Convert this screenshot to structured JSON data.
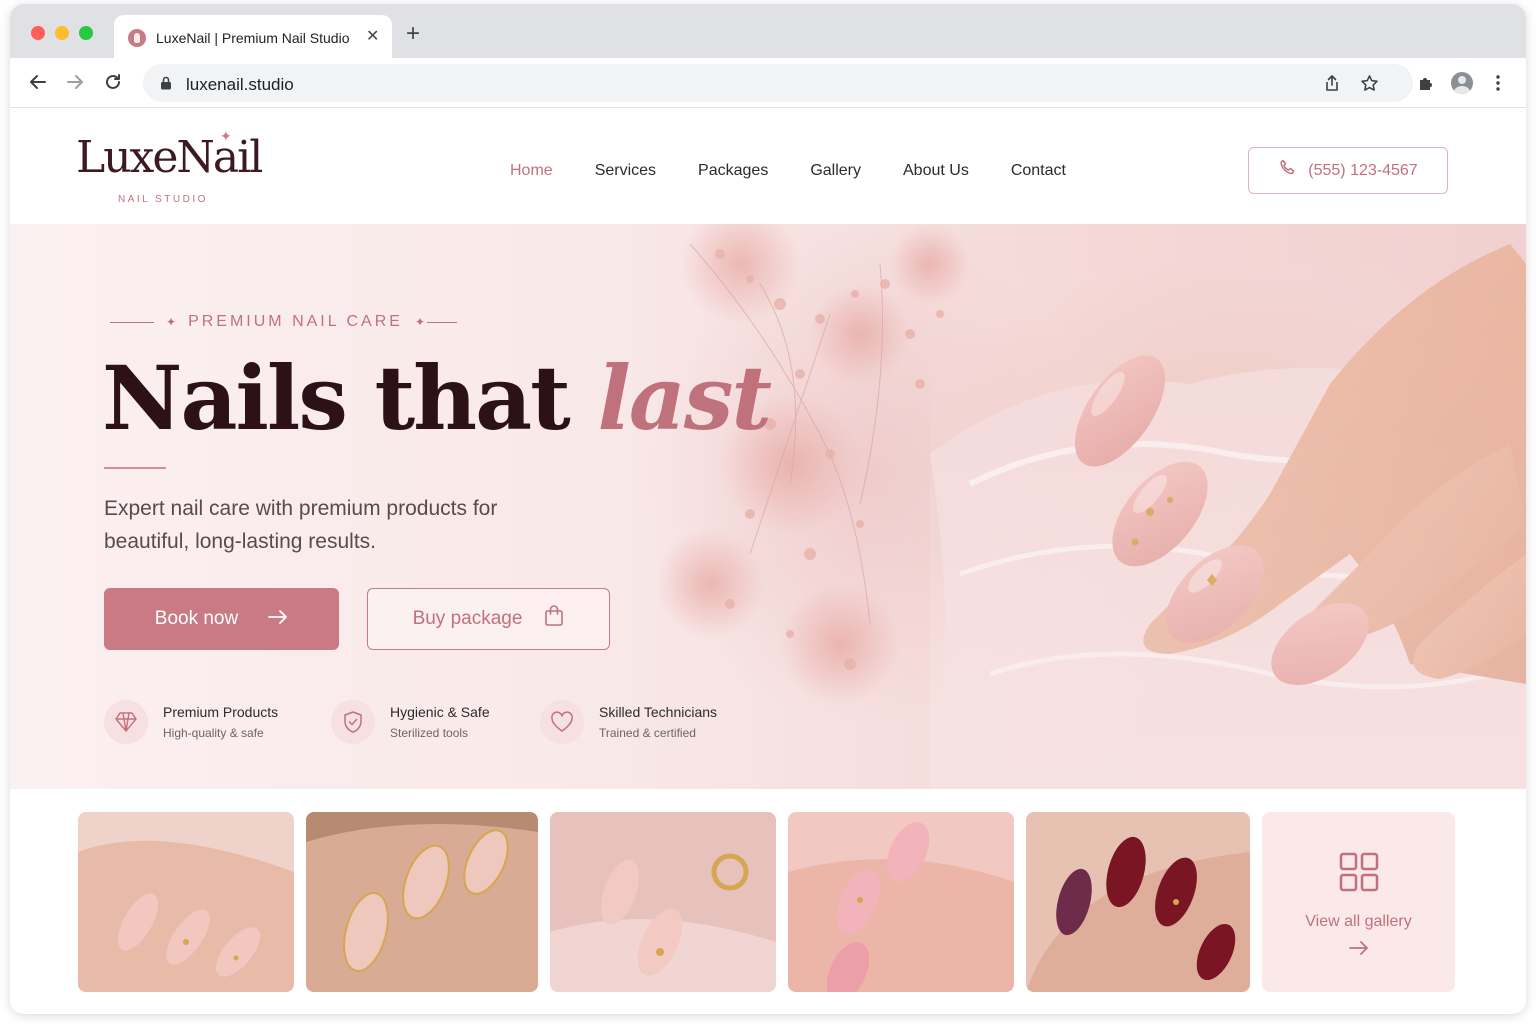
{
  "browser": {
    "tab_title": "LuxeNail | Premium Nail Studio",
    "url": "luxenail.studio",
    "icons": [
      "back-icon",
      "forward-icon",
      "reload-icon",
      "lock-icon",
      "share-icon",
      "star-icon",
      "extensions-icon",
      "profile-icon",
      "menu-icon"
    ]
  },
  "brand": {
    "name": "LuxeNail",
    "tagline": "NAIL STUDIO",
    "accent": "#c97a84",
    "dark": "#2c1218"
  },
  "nav": {
    "items": [
      {
        "label": "Home",
        "active": true
      },
      {
        "label": "Services"
      },
      {
        "label": "Packages"
      },
      {
        "label": "Gallery"
      },
      {
        "label": "About Us"
      },
      {
        "label": "Contact"
      }
    ],
    "phone": "(555) 123-4567"
  },
  "hero": {
    "eyebrow": "PREMIUM NAIL CARE",
    "headline_main": "Nails that ",
    "headline_accent": "last",
    "subtext": "Expert nail care with premium products for beautiful, long-lasting results.",
    "primary_cta": "Book now",
    "secondary_cta": "Buy package"
  },
  "features": [
    {
      "title": "Premium Products",
      "subtitle": "High-quality & safe",
      "icon": "diamond-icon"
    },
    {
      "title": "Hygienic & Safe",
      "subtitle": "Sterilized tools",
      "icon": "shield-check-icon"
    },
    {
      "title": "Skilled Technicians",
      "subtitle": "Trained & certified",
      "icon": "heart-icon"
    }
  ],
  "gallery": {
    "view_all_label": "View all gallery"
  }
}
